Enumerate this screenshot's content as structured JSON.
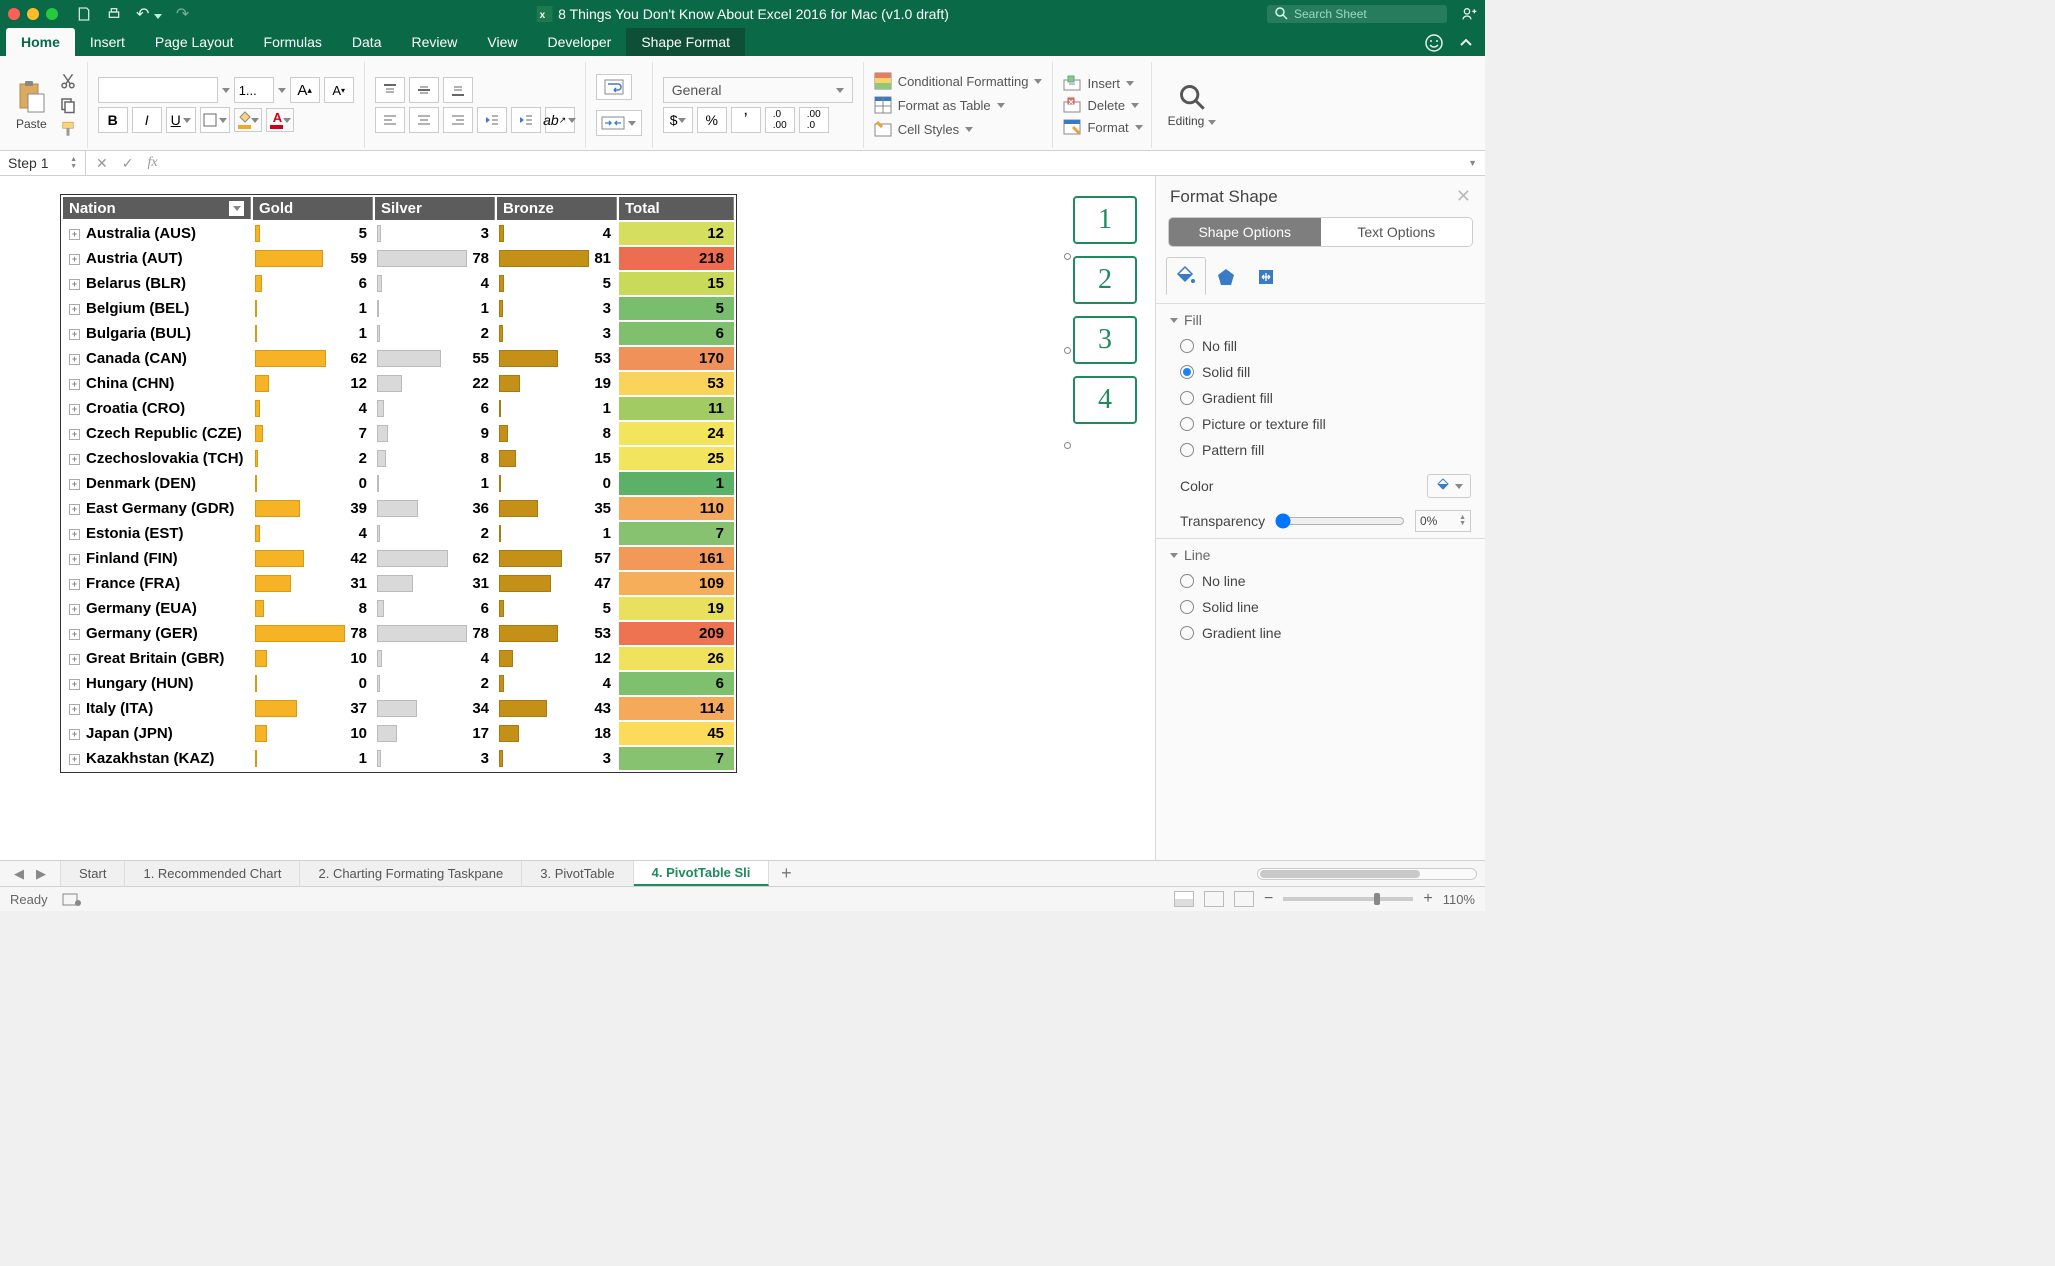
{
  "title": "8 Things You Don't Know About Excel 2016 for Mac (v1.0 draft)",
  "search_placeholder": "Search Sheet",
  "tabs": [
    "Home",
    "Insert",
    "Page Layout",
    "Formulas",
    "Data",
    "Review",
    "View",
    "Developer",
    "Shape Format"
  ],
  "active_tab": "Home",
  "ribbon": {
    "paste": "Paste",
    "editing": "Editing",
    "font_size": "1...",
    "number_format": "General",
    "cond_fmt": "Conditional Formatting",
    "fmt_table": "Format as Table",
    "cell_styles": "Cell Styles",
    "insert": "Insert",
    "delete": "Delete",
    "format": "Format"
  },
  "name_box": "Step 1",
  "table": {
    "headers": [
      "Nation",
      "Gold",
      "Silver",
      "Bronze",
      "Total"
    ],
    "rows": [
      {
        "nation": "Australia (AUS)",
        "gold": 5,
        "silver": 3,
        "bronze": 4,
        "total": 12,
        "tcolor": "#d6de5f"
      },
      {
        "nation": "Austria (AUT)",
        "gold": 59,
        "silver": 78,
        "bronze": 81,
        "total": 218,
        "tcolor": "#ec6d4f"
      },
      {
        "nation": "Belarus (BLR)",
        "gold": 6,
        "silver": 4,
        "bronze": 5,
        "total": 15,
        "tcolor": "#c9d95a"
      },
      {
        "nation": "Belgium (BEL)",
        "gold": 1,
        "silver": 1,
        "bronze": 3,
        "total": 5,
        "tcolor": "#79be6c"
      },
      {
        "nation": "Bulgaria (BUL)",
        "gold": 1,
        "silver": 2,
        "bronze": 3,
        "total": 6,
        "tcolor": "#7fc06e"
      },
      {
        "nation": "Canada (CAN)",
        "gold": 62,
        "silver": 55,
        "bronze": 53,
        "total": 170,
        "tcolor": "#f1915a"
      },
      {
        "nation": "China (CHN)",
        "gold": 12,
        "silver": 22,
        "bronze": 19,
        "total": 53,
        "tcolor": "#f9d35a"
      },
      {
        "nation": "Croatia (CRO)",
        "gold": 4,
        "silver": 6,
        "bronze": 1,
        "total": 11,
        "tcolor": "#a3cb63"
      },
      {
        "nation": "Czech Republic (CZE)",
        "gold": 7,
        "silver": 9,
        "bronze": 8,
        "total": 24,
        "tcolor": "#f3e45e"
      },
      {
        "nation": "Czechoslovakia (TCH)",
        "gold": 2,
        "silver": 8,
        "bronze": 15,
        "total": 25,
        "tcolor": "#f3e45e"
      },
      {
        "nation": "Denmark (DEN)",
        "gold": 0,
        "silver": 1,
        "bronze": 0,
        "total": 1,
        "tcolor": "#5bb168"
      },
      {
        "nation": "East Germany (GDR)",
        "gold": 39,
        "silver": 36,
        "bronze": 35,
        "total": 110,
        "tcolor": "#f5a95a"
      },
      {
        "nation": "Estonia (EST)",
        "gold": 4,
        "silver": 2,
        "bronze": 1,
        "total": 7,
        "tcolor": "#86c270"
      },
      {
        "nation": "Finland (FIN)",
        "gold": 42,
        "silver": 62,
        "bronze": 57,
        "total": 161,
        "tcolor": "#f2995a"
      },
      {
        "nation": "France (FRA)",
        "gold": 31,
        "silver": 31,
        "bronze": 47,
        "total": 109,
        "tcolor": "#f6ae5a"
      },
      {
        "nation": "Germany (EUA)",
        "gold": 8,
        "silver": 6,
        "bronze": 5,
        "total": 19,
        "tcolor": "#ebe05d"
      },
      {
        "nation": "Germany (GER)",
        "gold": 78,
        "silver": 78,
        "bronze": 53,
        "total": 209,
        "tcolor": "#ed7351"
      },
      {
        "nation": "Great Britain (GBR)",
        "gold": 10,
        "silver": 4,
        "bronze": 12,
        "total": 26,
        "tcolor": "#f1e25d"
      },
      {
        "nation": "Hungary (HUN)",
        "gold": 0,
        "silver": 2,
        "bronze": 4,
        "total": 6,
        "tcolor": "#7fc06e"
      },
      {
        "nation": "Italy (ITA)",
        "gold": 37,
        "silver": 34,
        "bronze": 43,
        "total": 114,
        "tcolor": "#f5a95a"
      },
      {
        "nation": "Japan (JPN)",
        "gold": 10,
        "silver": 17,
        "bronze": 18,
        "total": 45,
        "tcolor": "#fcdb5b"
      },
      {
        "nation": "Kazakhstan (KAZ)",
        "gold": 1,
        "silver": 3,
        "bronze": 3,
        "total": 7,
        "tcolor": "#86c270"
      }
    ],
    "max": {
      "gold": 78,
      "silver": 78,
      "bronze": 81
    }
  },
  "slicers": [
    "1",
    "2",
    "3",
    "4"
  ],
  "pane": {
    "title": "Format Shape",
    "tabs": [
      "Shape Options",
      "Text Options"
    ],
    "fill": {
      "title": "Fill",
      "options": [
        "No fill",
        "Solid fill",
        "Gradient fill",
        "Picture or texture fill",
        "Pattern fill"
      ],
      "selected": "Solid fill",
      "color_label": "Color",
      "transp_label": "Transparency",
      "transp_value": "0%"
    },
    "line": {
      "title": "Line",
      "options": [
        "No line",
        "Solid line",
        "Gradient line"
      ]
    }
  },
  "sheet_tabs": [
    "Start",
    "1. Recommended Chart",
    "2. Charting Formating Taskpane",
    "3. PivotTable",
    "4. PivotTable Sli"
  ],
  "active_sheet": 4,
  "status": {
    "ready": "Ready",
    "zoom": "110%"
  }
}
